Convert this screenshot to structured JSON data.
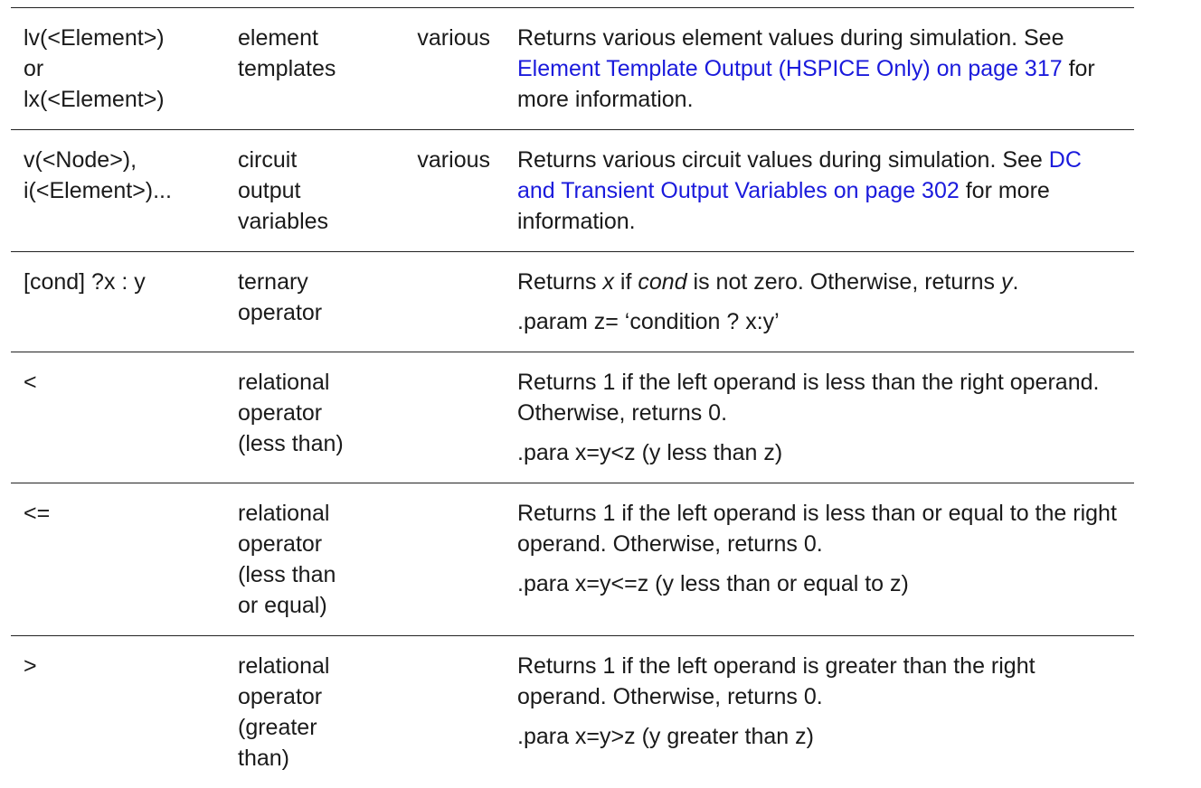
{
  "rows": [
    {
      "syntax": [
        "lv(<Element>)",
        "or",
        "lx(<Element>)"
      ],
      "function": "element templates",
      "type": "various",
      "desc": {
        "text1": "Returns various element values during simulation. See ",
        "link": "Element Template Output (HSPICE Only) on page 317",
        "text2": " for more information."
      }
    },
    {
      "syntax": [
        "v(<Node>),",
        "i(<Element>)..."
      ],
      "function": "circuit output variables",
      "type": "various",
      "desc": {
        "text1": "Returns various circuit values during simulation. See ",
        "link": "DC and Transient Output Variables on page 302",
        "text2": " for more information."
      }
    },
    {
      "syntax": [
        "[cond] ?x : y"
      ],
      "function": "ternary operator",
      "type": "",
      "desc": {
        "p1": "Returns ",
        "x": "x",
        "p2": " if ",
        "cond": "cond",
        "p3": " is not zero. Otherwise, returns ",
        "y": "y",
        "p4": "."
      },
      "example": " .param z= ‘condition ? x:y’"
    },
    {
      "syntax": [
        "<"
      ],
      "function": "relational operator (less than)",
      "type": "",
      "desc": {
        "text": "Returns 1 if the left operand is less than the right operand. Otherwise, returns 0."
      },
      "example": ".para x=y<z (y less than z)"
    },
    {
      "syntax": [
        "<="
      ],
      "function": "relational operator (less than or equal)",
      "type": "",
      "desc": {
        "text": "Returns 1 if the left operand is less than or equal to the right operand. Otherwise, returns 0."
      },
      "example": ".para x=y<=z (y less than or equal to z)"
    },
    {
      "syntax": [
        ">"
      ],
      "function": "relational operator (greater than)",
      "type": "",
      "desc": {
        "text": "Returns 1 if the left operand is greater than the right operand. Otherwise, returns 0."
      },
      "example": ".para x=y>z (y greater than z)"
    }
  ]
}
